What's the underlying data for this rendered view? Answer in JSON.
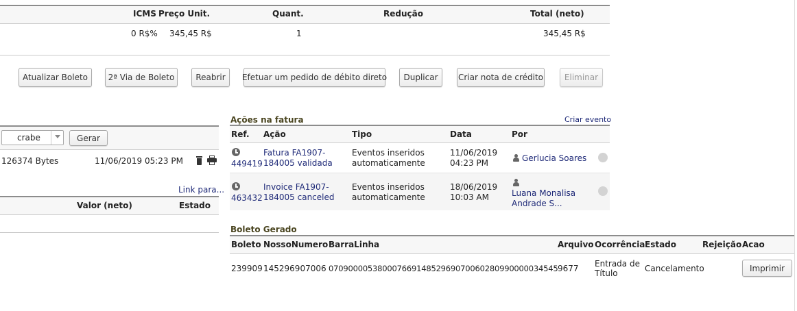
{
  "lines_table": {
    "headers": {
      "icms": "ICMS",
      "unit_price": "Preço Unit.",
      "qty": "Quant.",
      "reduction": "Redução",
      "total": "Total (neto)"
    },
    "row": {
      "icms": "0 R$%",
      "unit_price": "345,45 R$",
      "qty": "1",
      "total": "345,45 R$"
    }
  },
  "actions": {
    "update_boleto": "Atualizar Boleto",
    "second_copy": "2ª Via de Boleto",
    "reopen": "Reabrir",
    "direct_debit": "Efetuar um pedido de débito direto",
    "duplicate": "Duplicar",
    "credit_note": "Criar nota de crédito",
    "delete": "Eliminar"
  },
  "docs": {
    "select_value": "crabe",
    "generate_label": "Gerar",
    "file_size": "126374 Bytes",
    "file_date": "11/06/2019 05:23 PM",
    "link_label": "Link para..."
  },
  "payments_table": {
    "headers": {
      "value": "Valor (neto)",
      "status": "Estado"
    }
  },
  "events": {
    "title": "Ações na fatura",
    "create_event": "Criar evento",
    "headers": {
      "ref": "Ref.",
      "action": "Ação",
      "type": "Tipo",
      "date": "Data",
      "by": "Por"
    },
    "rows": [
      {
        "ref": "449419",
        "action_l1": "Fatura FA1907-",
        "action_l2": "184005 validada",
        "type_l1": "Eventos inseridos",
        "type_l2": "automaticamente",
        "date_l1": "11/06/2019",
        "date_l2": "04:23 PM",
        "by_l1": "Gerlucia Soares",
        "by_l2": ""
      },
      {
        "ref": "463432",
        "action_l1": "Invoice FA1907-",
        "action_l2": "184005 canceled",
        "type_l1": "Eventos inseridos",
        "type_l2": "automaticamente",
        "date_l1": "18/06/2019",
        "date_l2": "10:03 AM",
        "by_l1": "Luana Monalisa",
        "by_l2": "Andrade S..."
      }
    ]
  },
  "boleto": {
    "title": "Boleto Gerado",
    "headers": {
      "boleto": "Boleto",
      "nosso": "NossoNumero",
      "barra": "BarraLinha",
      "arquivo": "Arquivo",
      "ocorrencia": "Ocorrência",
      "estado": "Estado",
      "rejeicao": "Rejeição",
      "acao": "Acao"
    },
    "row": {
      "boleto": "239909",
      "nosso": "145296907006",
      "barra": "07090000538000766914852969070060280990000034545",
      "arquivo": "9677",
      "ocorrencia_l1": "Entrada de",
      "ocorrencia_l2": "Título",
      "estado": "Cancelamento",
      "print_label": "Imprimir"
    }
  }
}
